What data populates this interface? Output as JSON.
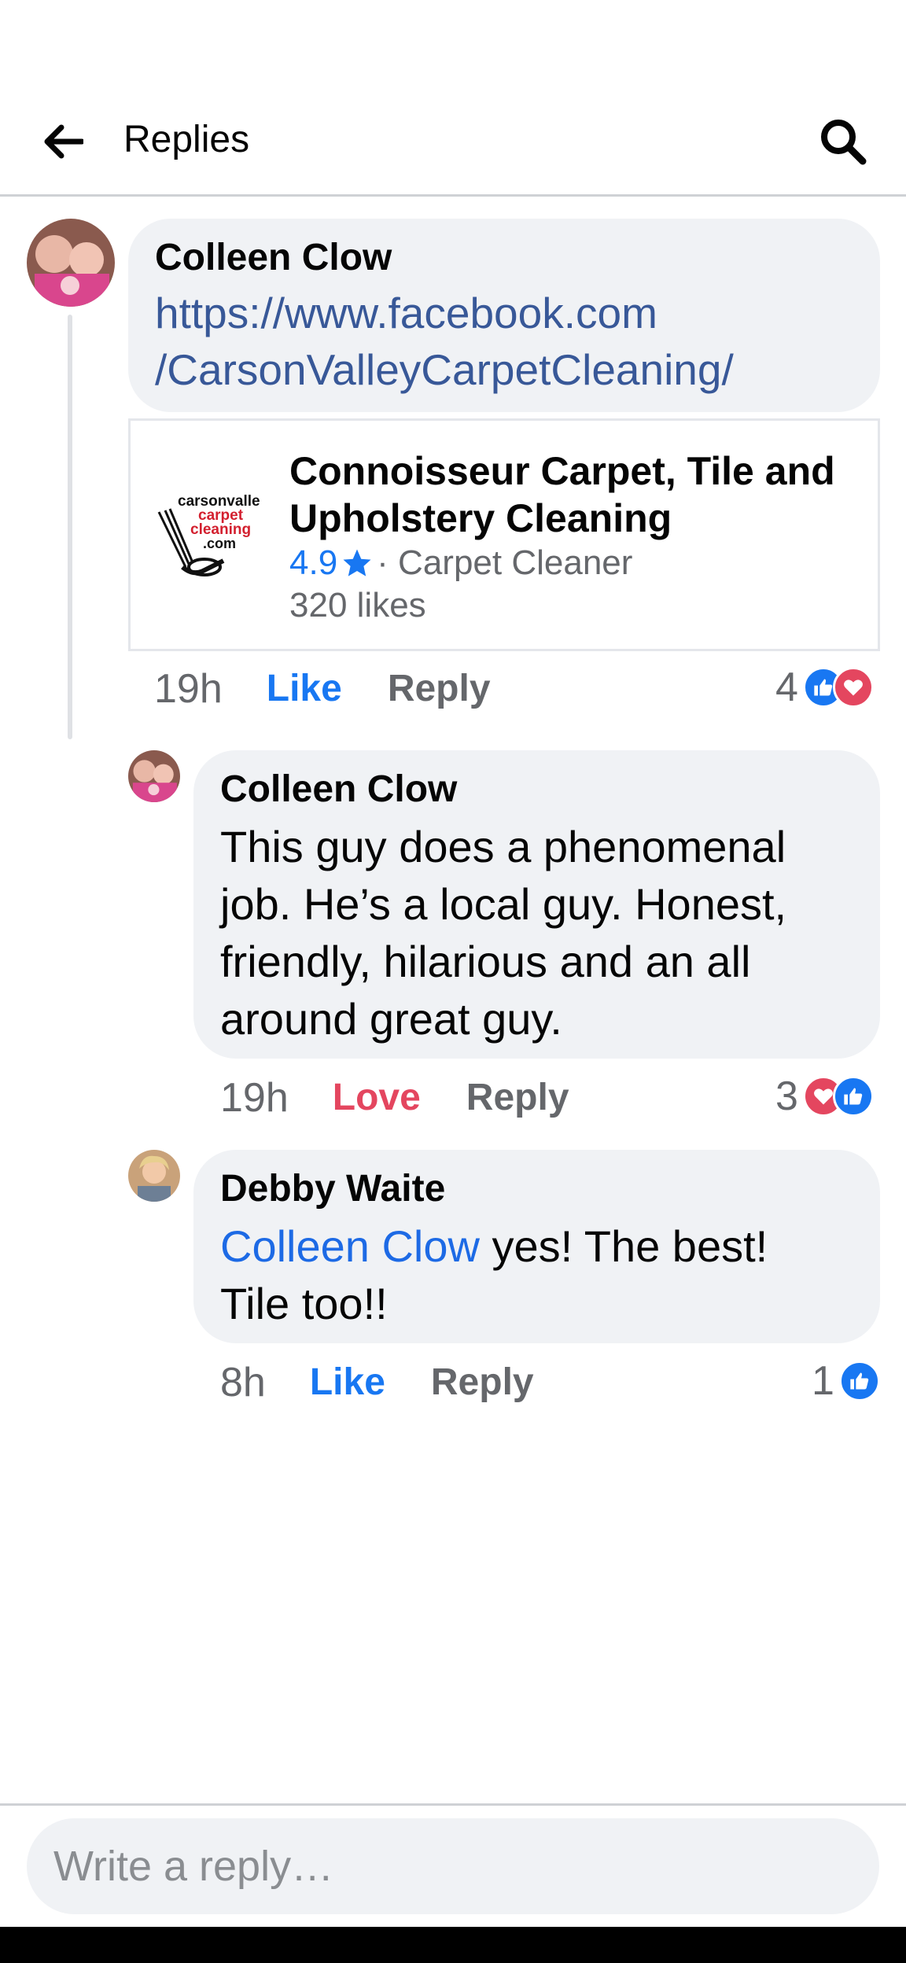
{
  "header": {
    "title": "Replies",
    "back_icon": "arrow-left-icon",
    "search_icon": "search-icon"
  },
  "comments": [
    {
      "author": "Colleen Clow",
      "link_text_line1": "https://www.facebook.com",
      "link_text_line2": "/CarsonValleyCarpetCleaning/",
      "preview": {
        "logo_line1": "carsonvalle",
        "logo_line2": "carpet",
        "logo_line3": "cleaning",
        "logo_line4": ".com",
        "title_line1": "Connoisseur Carpet, Tile and",
        "title_line2": "Upholstery Cleaning",
        "rating": "4.9",
        "category": "· Carpet Cleaner",
        "likes": "320 likes"
      },
      "time": "19h",
      "reaction_action": "Like",
      "reply_label": "Reply",
      "reaction_count": "4"
    },
    {
      "author": "Colleen Clow",
      "text_lines": [
        "This guy does a phenomenal",
        "job. He’s a local guy. Honest,",
        "friendly, hilarious and an all",
        "around great guy."
      ],
      "time": "19h",
      "reaction_action": "Love",
      "reply_label": "Reply",
      "reaction_count": "3"
    },
    {
      "author": "Debby Waite",
      "mention": "Colleen Clow",
      "text_line1_rest": " yes! The best!",
      "text_line2": "Tile too!!",
      "time": "8h",
      "reaction_action": "Like",
      "reply_label": "Reply",
      "reaction_count": "1"
    }
  ],
  "composer": {
    "placeholder": "Write a reply…"
  },
  "colors": {
    "accent_blue": "#1877f2",
    "love_red": "#e4465f",
    "bubble_bg": "#f0f2f5",
    "link_blue": "#385898"
  }
}
